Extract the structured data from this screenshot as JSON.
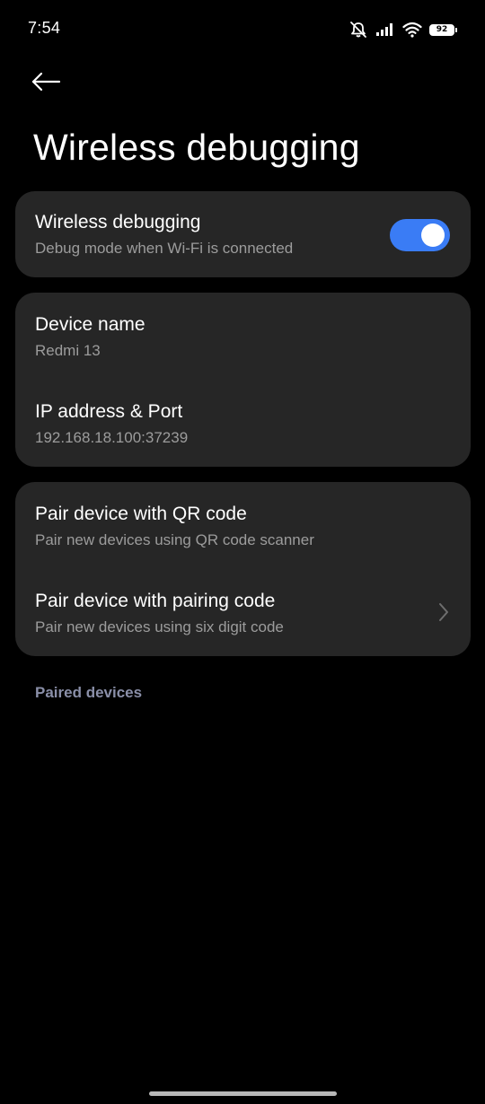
{
  "status_bar": {
    "time": "7:54",
    "battery_level": "92",
    "icons": [
      "mute-icon",
      "signal-icon",
      "wifi-icon",
      "battery-icon"
    ]
  },
  "header": {
    "back_icon": "arrow-left-icon",
    "title": "Wireless debugging"
  },
  "wireless_debugging": {
    "title": "Wireless debugging",
    "subtitle": "Debug mode when Wi-Fi is connected",
    "enabled": true,
    "accent_color": "#3a7cf5"
  },
  "device_info": {
    "device_name_label": "Device name",
    "device_name_value": "Redmi 13",
    "ip_label": "IP address & Port",
    "ip_value": "192.168.18.100:37239"
  },
  "pairing": {
    "qr_title": "Pair device with QR code",
    "qr_subtitle": "Pair new devices using QR code scanner",
    "code_title": "Pair device with pairing code",
    "code_subtitle": "Pair new devices using six digit code",
    "chevron_icon": "chevron-right-icon"
  },
  "paired_devices": {
    "header": "Paired devices"
  }
}
